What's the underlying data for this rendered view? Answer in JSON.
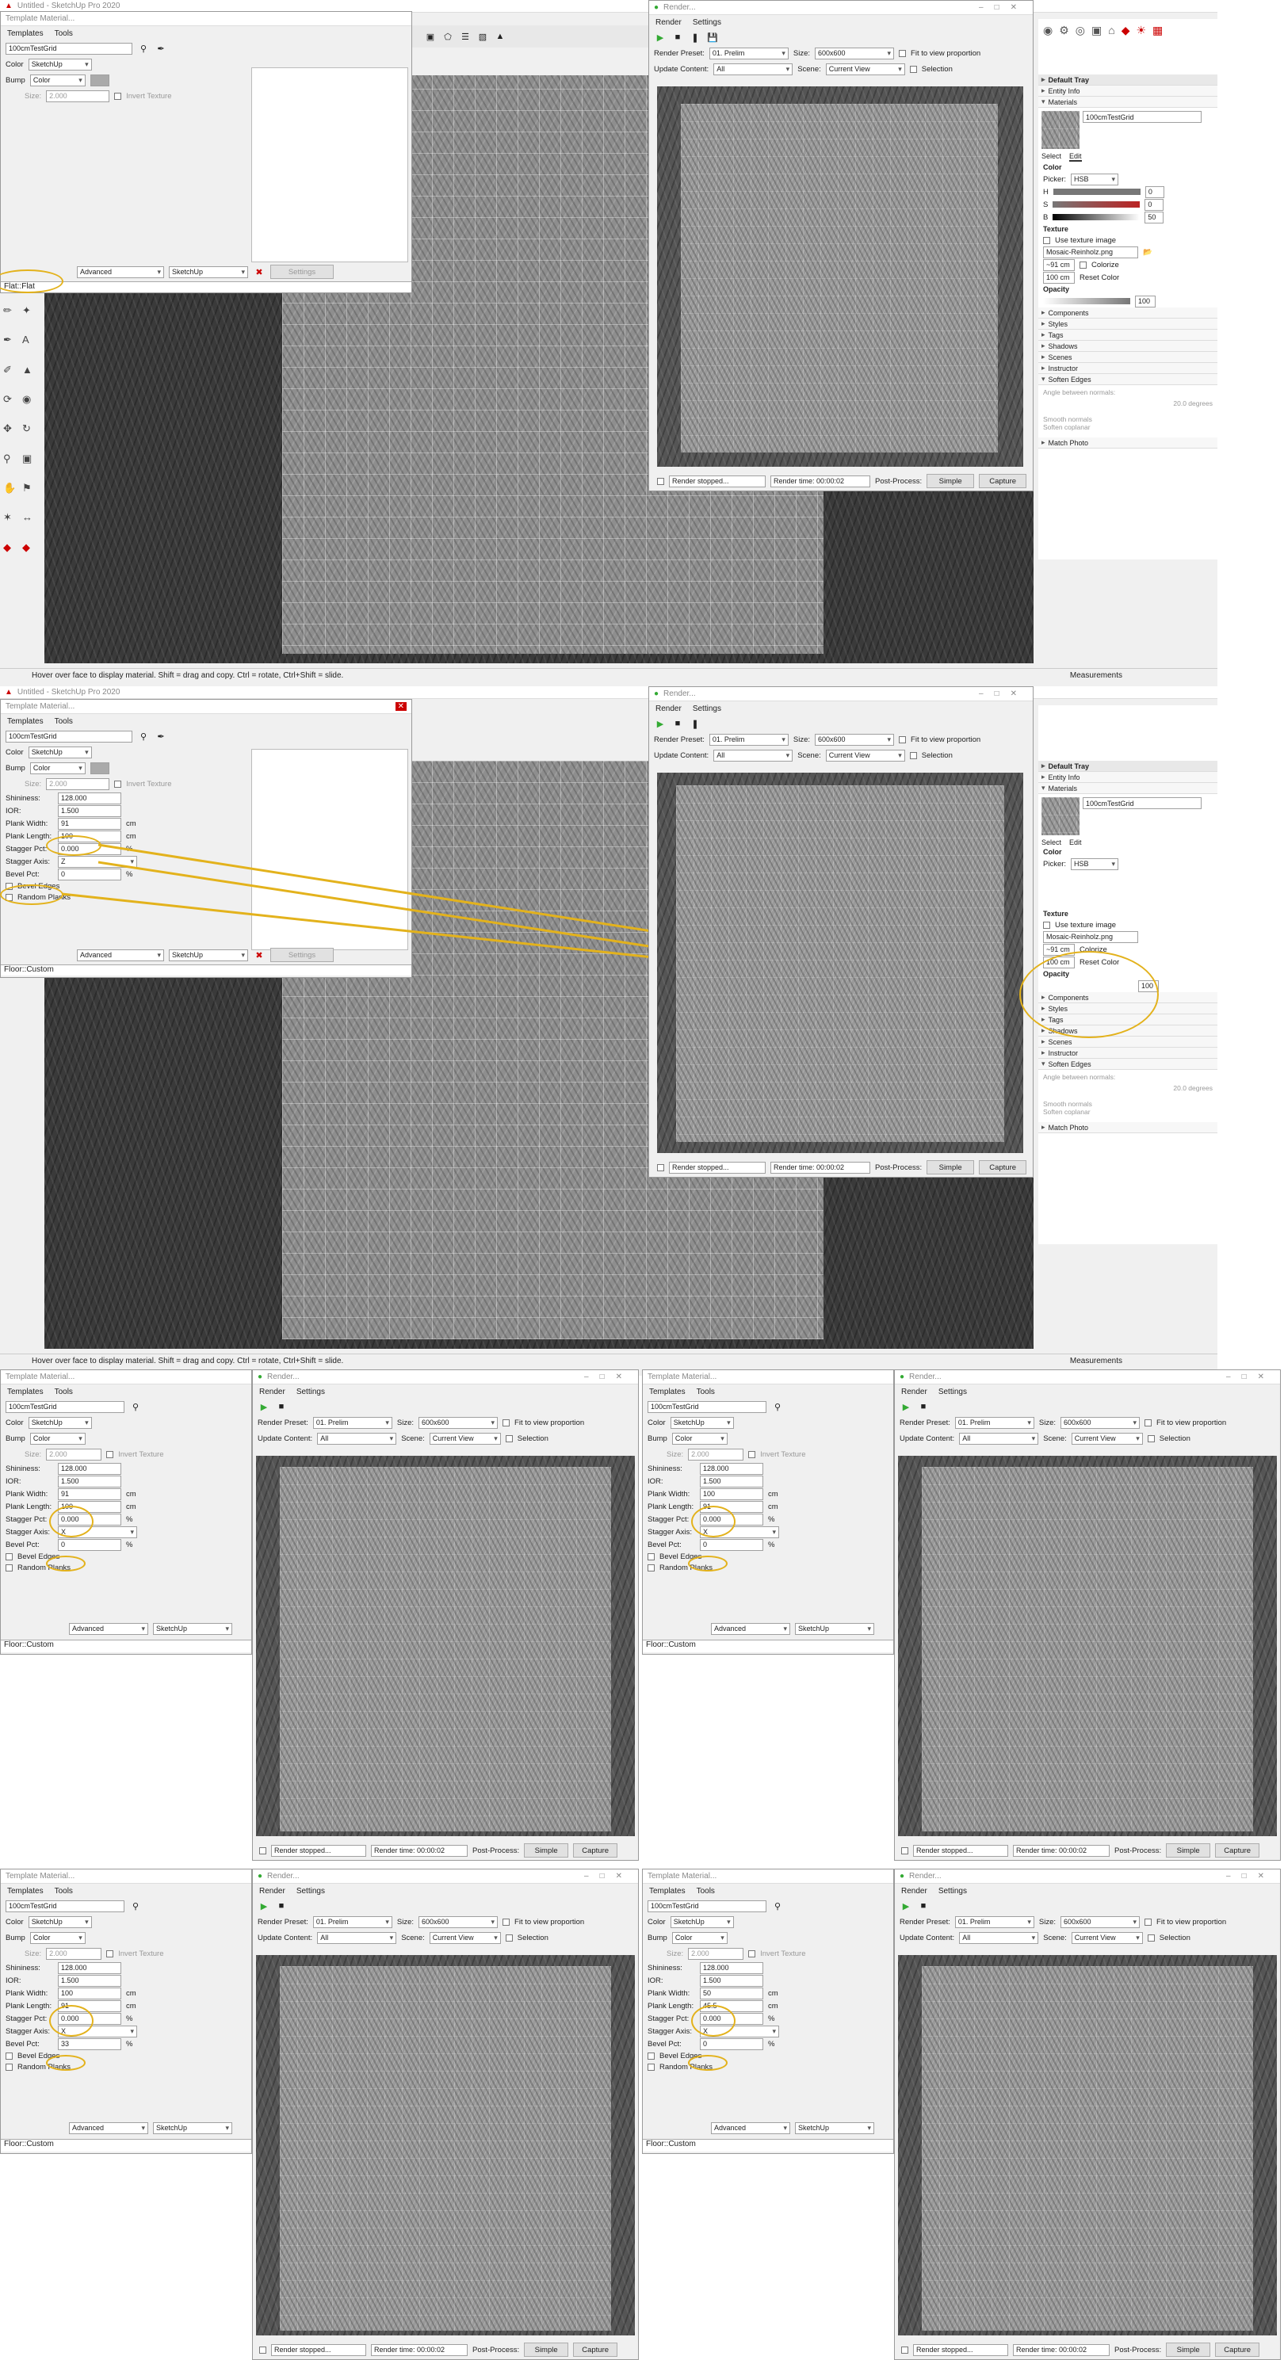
{
  "app": {
    "title": "Untitled - SketchUp Pro 2020",
    "status_hint": "Hover over face to display material. Shift = drag and copy. Ctrl = rotate, Ctrl+Shift = slide.",
    "measurements_label": "Measurements"
  },
  "material_dialog": {
    "title": "Template Material...",
    "menu": [
      "Templates",
      "Tools"
    ],
    "name": "100cmTestGrid",
    "color_label": "Color",
    "color_value": "SketchUp",
    "bump_label": "Bump",
    "bump_value": "Color",
    "size_label": "Size:",
    "size_value": "2.000",
    "invert_label": "Invert Texture",
    "shininess_label": "Shininess:",
    "shininess_value": "128.000",
    "ior_label": "IOR:",
    "ior_value": "1.500",
    "plank_width_label": "Plank Width:",
    "plank_length_label": "Plank Length:",
    "stagger_pct_label": "Stagger Pct:",
    "stagger_axis_label": "Stagger Axis:",
    "bevel_pct_label": "Bevel Pct:",
    "bevel_edges_label": "Bevel Edges",
    "random_planks_label": "Random Planks",
    "unit_cm": "cm",
    "unit_pct": "%",
    "advanced_label": "Advanced",
    "sketchup_label": "SketchUp",
    "settings_label": "Settings",
    "footer_flat": "Flat::Flat",
    "footer_floor": "Floor::Custom"
  },
  "render_window": {
    "title": "Render...",
    "menu": [
      "Render",
      "Settings"
    ],
    "preset_label": "Render Preset:",
    "preset_value": "01. Prelim",
    "size_label": "Size:",
    "size_value": "600x600",
    "fit_label": "Fit to view proportion",
    "update_label": "Update Content:",
    "update_value": "All",
    "scene_label": "Scene:",
    "scene_value": "Current View",
    "selection_label": "Selection",
    "status": "Render stopped...",
    "time": "Render time: 00:00:02",
    "postprocess_label": "Post-Process:",
    "simple_label": "Simple",
    "capture_label": "Capture"
  },
  "tray": {
    "title": "Default Tray",
    "entity_info": "Entity Info",
    "materials": "Materials",
    "material_name": "100cmTestGrid",
    "tab_select": "Select",
    "tab_edit": "Edit",
    "color_heading": "Color",
    "picker_label": "Picker:",
    "picker_value": "HSB",
    "h_label": "H",
    "h_value": "0",
    "s_label": "S",
    "s_value": "0",
    "b_label": "B",
    "b_value": "50",
    "texture_heading": "Texture",
    "use_texture_label": "Use texture image",
    "texture_file": "Mosaic-Reinholz.png",
    "tex_width": "~91 cm",
    "tex_height": "100 cm",
    "colorize_label": "Colorize",
    "reset_color_label": "Reset Color",
    "opacity_heading": "Opacity",
    "opacity_value": "100",
    "sections": [
      "Components",
      "Styles",
      "Tags",
      "Shadows",
      "Scenes",
      "Instructor"
    ],
    "soften_edges": "Soften Edges",
    "angle_label": "Angle between normals:",
    "angle_value": "20.0  degrees",
    "smooth_normals": "Smooth normals",
    "soften_coplanar": "Soften coplanar",
    "match_photo": "Match Photo"
  },
  "variants": [
    {
      "plank_width": "91",
      "plank_length": "100",
      "stagger_pct": "0.000",
      "stagger_axis": "Z",
      "bevel_pct": "0"
    },
    {
      "plank_width": "91",
      "plank_length": "100",
      "stagger_pct": "0.000",
      "stagger_axis": "X",
      "bevel_pct": "0"
    },
    {
      "plank_width": "100",
      "plank_length": "91",
      "stagger_pct": "0.000",
      "stagger_axis": "X",
      "bevel_pct": "0"
    },
    {
      "plank_width": "100",
      "plank_length": "91",
      "stagger_pct": "0.000",
      "stagger_axis": "X",
      "bevel_pct": "33"
    },
    {
      "plank_width": "50",
      "plank_length": "45.5",
      "stagger_pct": "0.000",
      "stagger_axis": "X",
      "bevel_pct": "0"
    }
  ],
  "colors": {
    "highlight": "#e3b21c",
    "hue_bar": "#c0392b",
    "tray_accent": "#d9d9d9"
  }
}
